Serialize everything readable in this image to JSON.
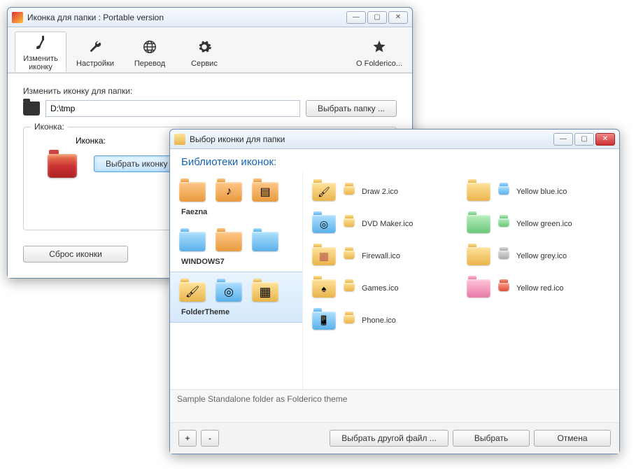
{
  "main": {
    "title": "Иконка для папки : Portable version",
    "toolbar": {
      "change": "Изменить\nиконку",
      "settings": "Настройки",
      "translate": "Перевод",
      "service": "Сервис",
      "about": "О Folderico..."
    },
    "change_label": "Изменить иконку для папки:",
    "path": "D:\\tmp",
    "browse_btn": "Выбрать папку ...",
    "icon_group": "Иконка:",
    "icon_label": "Иконка:",
    "pick_icon_btn": "Выбрать иконку ...",
    "reset_btn": "Сброс иконки"
  },
  "dialog": {
    "title": "Выбор иконки для папки",
    "header": "Библиотеки иконок:",
    "libs": [
      {
        "name": "Faezna"
      },
      {
        "name": "WINDOWS7"
      },
      {
        "name": "FolderTheme"
      }
    ],
    "items_col1": [
      {
        "name": "Draw 2.ico"
      },
      {
        "name": "DVD Maker.ico"
      },
      {
        "name": "Firewall.ico"
      },
      {
        "name": "Games.ico"
      },
      {
        "name": "Phone.ico"
      }
    ],
    "items_col2": [
      {
        "name": "Yellow blue.ico"
      },
      {
        "name": "Yellow green.ico"
      },
      {
        "name": "Yellow grey.ico"
      },
      {
        "name": "Yellow red.ico"
      }
    ],
    "desc": "Sample Standalone folder as Folderico theme",
    "plus": "+",
    "minus": "-",
    "pick_other": "Выбрать другой файл ...",
    "pick": "Выбрать",
    "cancel": "Отмена"
  }
}
